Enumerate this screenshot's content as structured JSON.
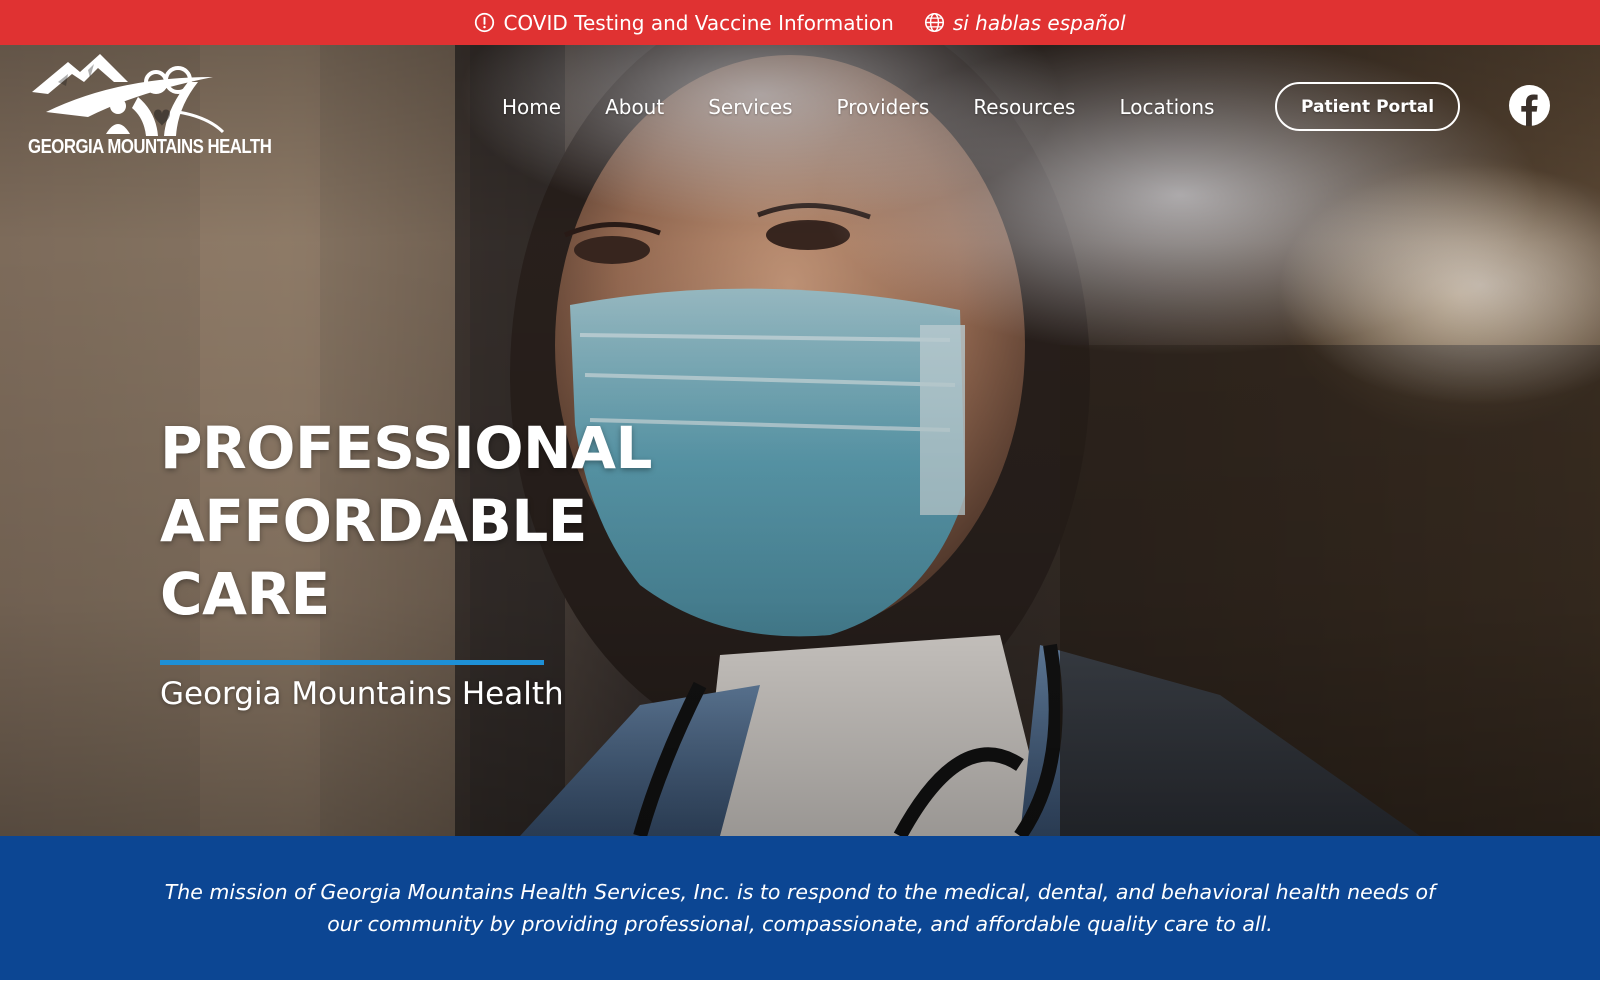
{
  "alert_bar": {
    "covid_label": "COVID Testing and Vaccine Information",
    "spanish_label": "si hablas español",
    "background": "#e03232"
  },
  "header": {
    "logo_text": "GEORGIA MOUNTAINS HEALTH",
    "nav": [
      "Home",
      "About",
      "Services",
      "Providers",
      "Resources",
      "Locations"
    ],
    "portal_button": "Patient Portal",
    "social_icon": "facebook-icon"
  },
  "hero": {
    "title_lines": [
      "PROFESSIONAL",
      "AFFORDABLE",
      "CARE"
    ],
    "subtitle": "Georgia Mountains Health",
    "accent_color": "#1e90d6"
  },
  "mission": {
    "text": "The mission of Georgia Mountains Health Services, Inc. is to respond to the medical, dental, and behavioral health needs of our community by providing professional, compassionate, and affordable quality care to all.",
    "background": "#0c4693"
  }
}
